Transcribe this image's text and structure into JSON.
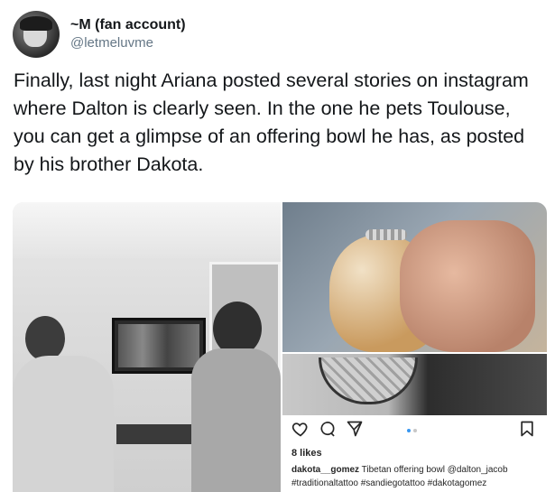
{
  "tweet": {
    "display_name": "~M (fan account)",
    "handle": "@letmeluvme",
    "text": "Finally, last night Ariana posted several stories on instagram where Dalton is clearly seen. In the one he pets Toulouse, you can get a glimpse of an offering bowl he has, as posted by his brother Dakota."
  },
  "instagram_post": {
    "likes": "8 likes",
    "username": "dakota__gomez",
    "caption": " Tibetan offering bowl @dalton_jacob #traditionaltattoo #sandiegotattoo #dakotagomez",
    "icons": [
      "heart-icon",
      "comment-icon",
      "share-icon",
      "bookmark-icon"
    ],
    "carousel": {
      "count": 2,
      "active": 0
    }
  },
  "colors": {
    "text_primary": "#14171a",
    "text_secondary": "#657786",
    "carousel_active": "#3897f0",
    "carousel_inactive": "#c7c7c7"
  }
}
